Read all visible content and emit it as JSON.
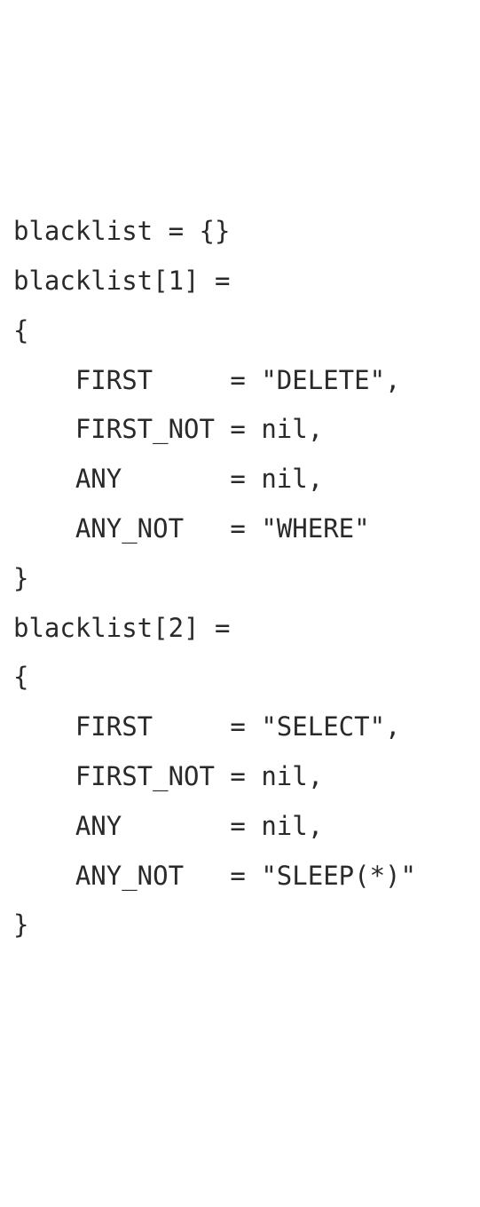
{
  "code": {
    "lines": [
      "blacklist = {}",
      "blacklist[1] =",
      "{",
      "    FIRST     = \"DELETE\",",
      "    FIRST_NOT = nil,",
      "    ANY       = nil,",
      "    ANY_NOT   = \"WHERE\"",
      "}",
      "blacklist[2] =",
      "{",
      "    FIRST     = \"SELECT\",",
      "    FIRST_NOT = nil,",
      "    ANY       = nil,",
      "    ANY_NOT   = \"SLEEP(*)\"",
      "}"
    ]
  }
}
